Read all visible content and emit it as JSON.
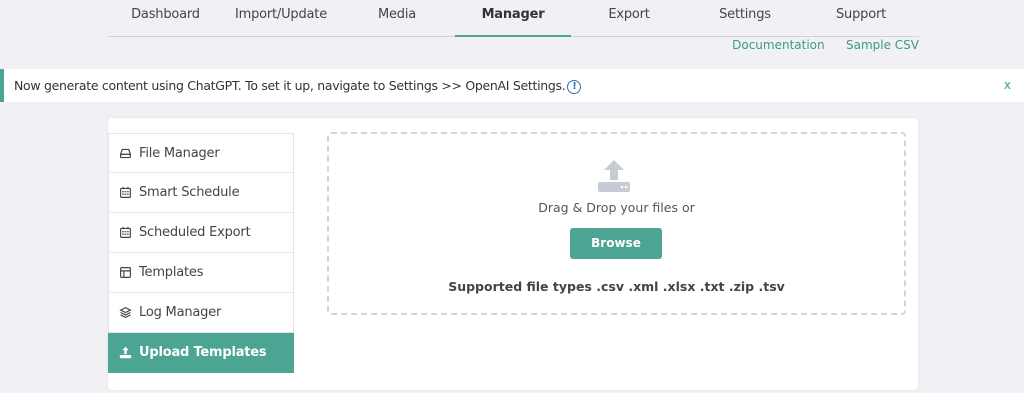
{
  "nav": {
    "tabs": [
      "Dashboard",
      "Import/Update",
      "Media",
      "Manager",
      "Export",
      "Settings",
      "Support"
    ],
    "active": "Manager",
    "links": [
      "Documentation",
      "Sample CSV"
    ]
  },
  "notice": {
    "text": "Now generate content using ChatGPT. To set it up, navigate to Settings >> OpenAI Settings.",
    "info_icon": "!",
    "close": "x"
  },
  "sidebar": {
    "items": [
      {
        "label": "File Manager",
        "icon": "drive-icon"
      },
      {
        "label": "Smart Schedule",
        "icon": "calendar-icon"
      },
      {
        "label": "Scheduled Export",
        "icon": "calendar-icon"
      },
      {
        "label": "Templates",
        "icon": "template-icon"
      },
      {
        "label": "Log Manager",
        "icon": "layers-icon"
      },
      {
        "label": "Upload Templates",
        "icon": "upload-icon"
      }
    ],
    "active_index": 5
  },
  "dropzone": {
    "prompt": "Drag & Drop your files or",
    "browse": "Browse",
    "supported": "Supported file types .csv .xml .xlsx .txt .zip .tsv"
  },
  "colors": {
    "accent": "#4ca592",
    "background": "#f1f1f5",
    "link": "#3d9a86"
  }
}
